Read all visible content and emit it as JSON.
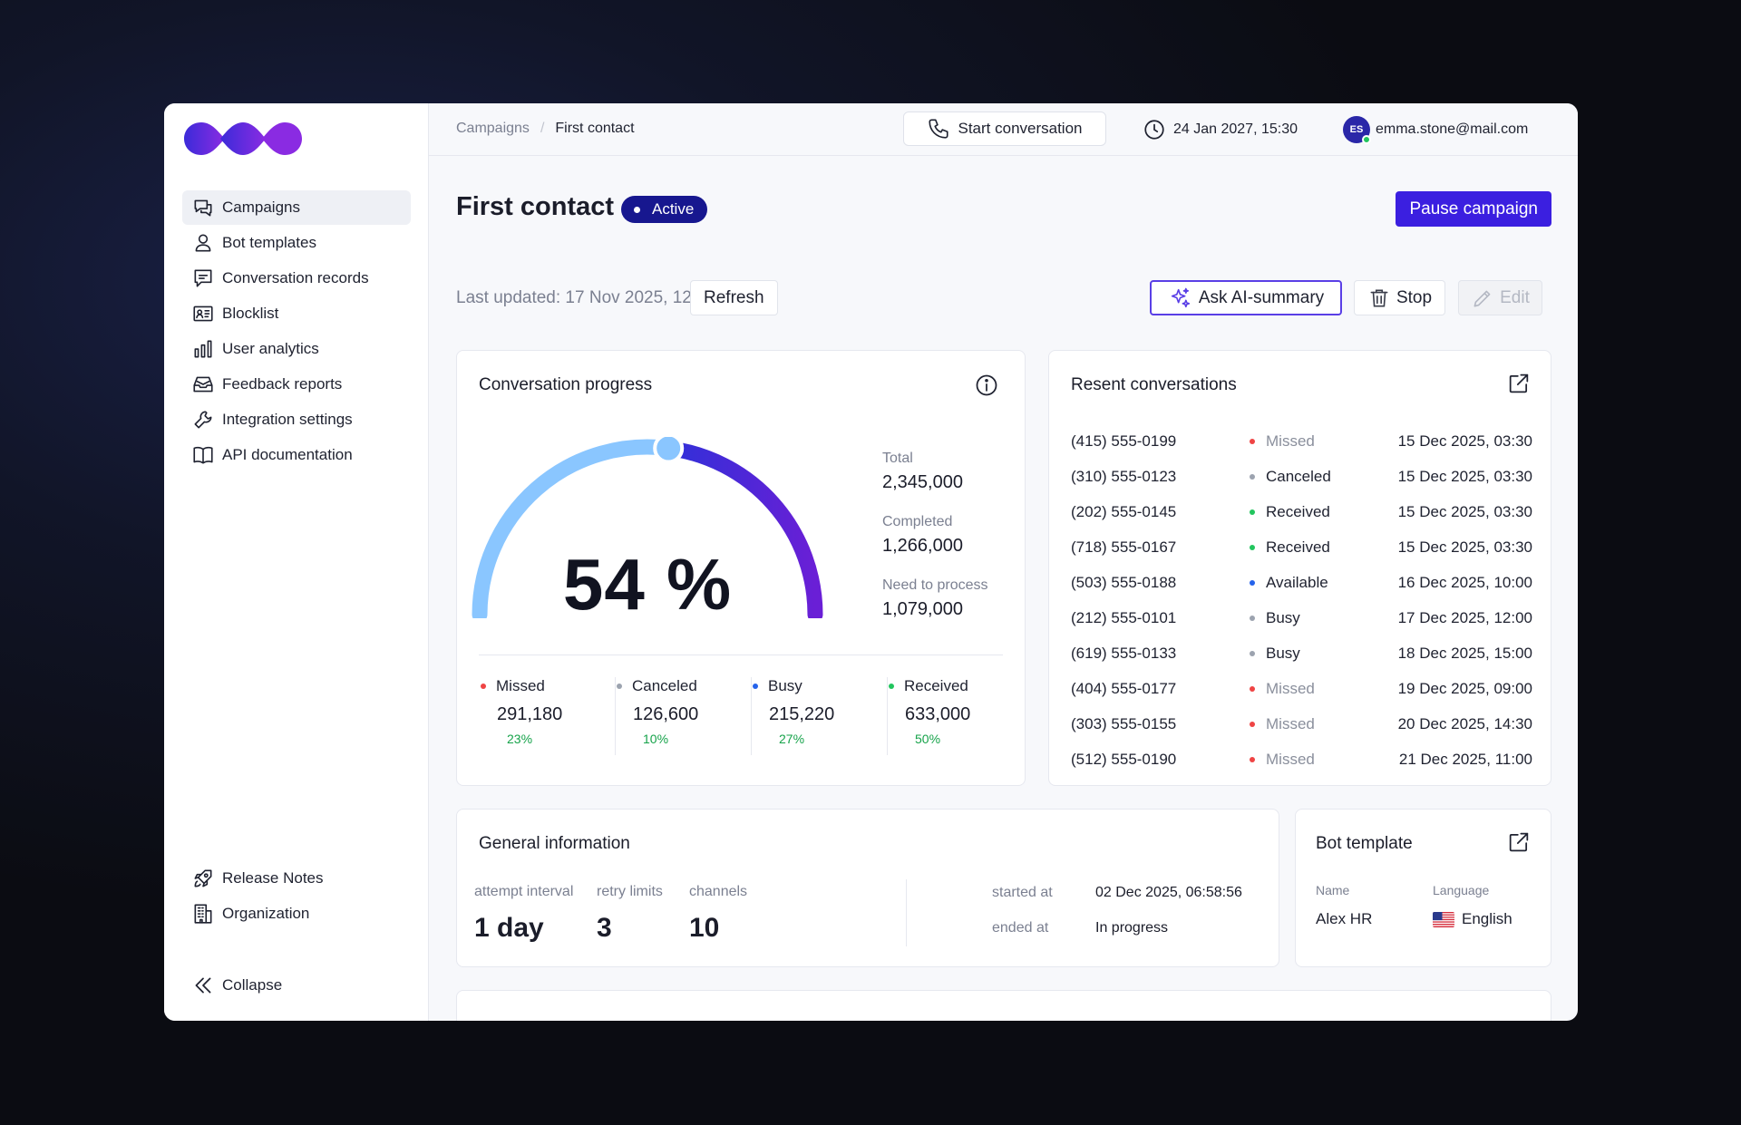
{
  "sidebar": {
    "items": [
      {
        "label": "Campaigns",
        "icon": "chat-bubbles-icon",
        "active": true
      },
      {
        "label": "Bot templates",
        "icon": "user-icon"
      },
      {
        "label": "Conversation records",
        "icon": "message-icon"
      },
      {
        "label": "Blocklist",
        "icon": "contact-card-icon"
      },
      {
        "label": "User analytics",
        "icon": "bar-chart-icon"
      },
      {
        "label": "Feedback reports",
        "icon": "inbox-icon"
      },
      {
        "label": "Integration settings",
        "icon": "wrench-icon"
      },
      {
        "label": "API documentation",
        "icon": "book-icon"
      }
    ],
    "bottom_items": [
      {
        "label": "Release Notes",
        "icon": "rocket-icon"
      },
      {
        "label": "Organization",
        "icon": "building-icon"
      }
    ],
    "collapse_label": "Collapse"
  },
  "topbar": {
    "breadcrumb": {
      "parent": "Campaigns",
      "current": "First contact"
    },
    "start_conversation": "Start conversation",
    "datetime": "24 Jan 2027, 15:30",
    "user": {
      "initials": "ES",
      "email": "emma.stone@mail.com"
    }
  },
  "page": {
    "title": "First contact",
    "status": "Active",
    "pause_label": "Pause campaign",
    "last_updated": "Last updated: 17 Nov 2025, 12:00",
    "refresh_label": "Refresh",
    "ai_label": "Ask AI-summary",
    "stop_label": "Stop",
    "edit_label": "Edit"
  },
  "progress": {
    "title": "Conversation progress",
    "percent": 54,
    "percent_text": "54 %",
    "totals": [
      {
        "label": "Total",
        "value": "2,345,000"
      },
      {
        "label": "Completed",
        "value": "1,266,000"
      },
      {
        "label": "Need to process",
        "value": "1,079,000"
      }
    ],
    "stats": [
      {
        "label": "Missed",
        "value": "291,180",
        "pct": "23%",
        "color": "#ef4444"
      },
      {
        "label": "Canceled",
        "value": "126,600",
        "pct": "10%",
        "color": "#9ca3af"
      },
      {
        "label": "Busy",
        "value": "215,220",
        "pct": "27%",
        "color": "#2563eb"
      },
      {
        "label": "Received",
        "value": "633,000",
        "pct": "50%",
        "color": "#22c55e"
      }
    ]
  },
  "recent": {
    "title": "Resent conversations",
    "rows": [
      {
        "phone": "(415) 555-0199",
        "status": "Missed",
        "date": "15 Dec 2025, 03:30"
      },
      {
        "phone": "(310) 555-0123",
        "status": "Canceled",
        "date": "15 Dec 2025, 03:30"
      },
      {
        "phone": "(202) 555-0145",
        "status": "Received",
        "date": "15 Dec 2025, 03:30"
      },
      {
        "phone": "(718) 555-0167",
        "status": "Received",
        "date": "15 Dec 2025, 03:30"
      },
      {
        "phone": "(503) 555-0188",
        "status": "Available",
        "date": "16 Dec 2025, 10:00"
      },
      {
        "phone": "(212) 555-0101",
        "status": "Busy",
        "date": "17 Dec 2025, 12:00"
      },
      {
        "phone": "(619) 555-0133",
        "status": "Busy",
        "date": "18 Dec 2025, 15:00"
      },
      {
        "phone": "(404) 555-0177",
        "status": "Missed",
        "date": "19 Dec 2025, 09:00"
      },
      {
        "phone": "(303) 555-0155",
        "status": "Missed",
        "date": "20 Dec 2025, 14:30"
      },
      {
        "phone": "(512) 555-0190",
        "status": "Missed",
        "date": "21 Dec 2025, 11:00"
      }
    ],
    "status_styles": {
      "Missed": {
        "dot": "#ef4444",
        "text": "#8a8f9c"
      },
      "Canceled": {
        "dot": "#9ca3af",
        "text": "#1f2230"
      },
      "Received": {
        "dot": "#22c55e",
        "text": "#1f2230"
      },
      "Available": {
        "dot": "#2563eb",
        "text": "#1f2230"
      },
      "Busy": {
        "dot": "#9ca3af",
        "text": "#1f2230"
      }
    }
  },
  "general": {
    "title": "General information",
    "columns": [
      {
        "label": "attempt interval",
        "value": "1 day"
      },
      {
        "label": "retry limits",
        "value": "3"
      },
      {
        "label": "channels",
        "value": "10"
      }
    ],
    "started_label": "started at",
    "started_value": "02 Dec 2025, 06:58:56",
    "ended_label": "ended at",
    "ended_value": "In progress"
  },
  "bot_template": {
    "title": "Bot template",
    "name_label": "Name",
    "name_value": "Alex HR",
    "language_label": "Language",
    "language_value": "English",
    "language_flag": "us-flag-icon"
  },
  "colors": {
    "accent": "#3b1fe0",
    "badge": "#17178f",
    "gauge_start": "#8ac6ff",
    "gauge_end": "#5a1fd6",
    "success": "#16a34a"
  }
}
